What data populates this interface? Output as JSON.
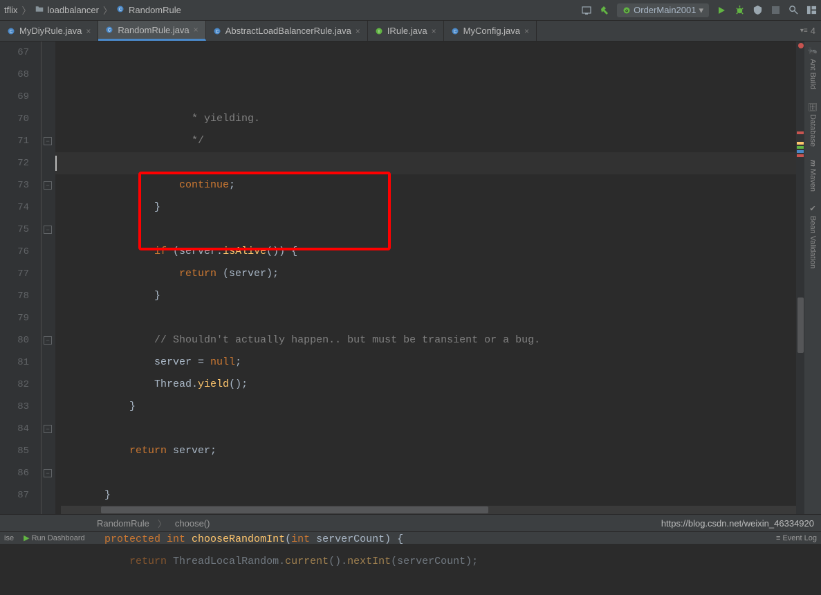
{
  "breadcrumb": {
    "item1": "tflix",
    "item2": "loadbalancer",
    "item3": "RandomRule"
  },
  "runConfig": {
    "label": "OrderMain2001"
  },
  "tabs": [
    {
      "label": "MyDiyRule.java"
    },
    {
      "label": "RandomRule.java"
    },
    {
      "label": "AbstractLoadBalancerRule.java"
    },
    {
      "label": "IRule.java"
    },
    {
      "label": "MyConfig.java"
    }
  ],
  "tabsCount": "4",
  "lines": {
    "start": 67,
    "end": 87
  },
  "code": {
    "l67": " * yielding.",
    "l68": " */",
    "l69_a": "Thread.",
    "l69_b": "yield",
    "l69_c": "();",
    "l70_a": "continue",
    "l70_b": ";",
    "l71": "}",
    "l72": "",
    "l73_a": "if",
    "l73_b": " (server.",
    "l73_c": "isAlive",
    "l73_d": "()) {",
    "l74_a": "return",
    "l74_b": " (server);",
    "l75": "}",
    "l76": "",
    "l77": "// Shouldn't actually happen.. but must be transient or a bug.",
    "l78_a": "server = ",
    "l78_b": "null",
    "l78_c": ";",
    "l79_a": "Thread.",
    "l79_b": "yield",
    "l79_c": "();",
    "l80": "}",
    "l81": "",
    "l82_a": "return",
    "l82_b": " server;",
    "l83": "",
    "l84": "}",
    "l85": "",
    "l86_a": "protected",
    "l86_b": " int ",
    "l86_c": "chooseRandomInt",
    "l86_d": "(",
    "l86_e": "int",
    "l86_f": " serverCount) {",
    "l87_a": "return",
    "l87_b": " ThreadLocalRandom.",
    "l87_c": "current",
    "l87_d": "().",
    "l87_e": "nextInt",
    "l87_f": "(serverCount);"
  },
  "editorCrumb": {
    "class": "RandomRule",
    "method": "choose()"
  },
  "status": {
    "left1": "ise",
    "left2": "Run Dashboard",
    "right1": "Event Log"
  },
  "rightTools": {
    "ant": "Ant Build",
    "db": "Database",
    "mvn": "Maven",
    "bean": "Bean Validation"
  },
  "watermark": "https://blog.csdn.net/weixin_46334920"
}
